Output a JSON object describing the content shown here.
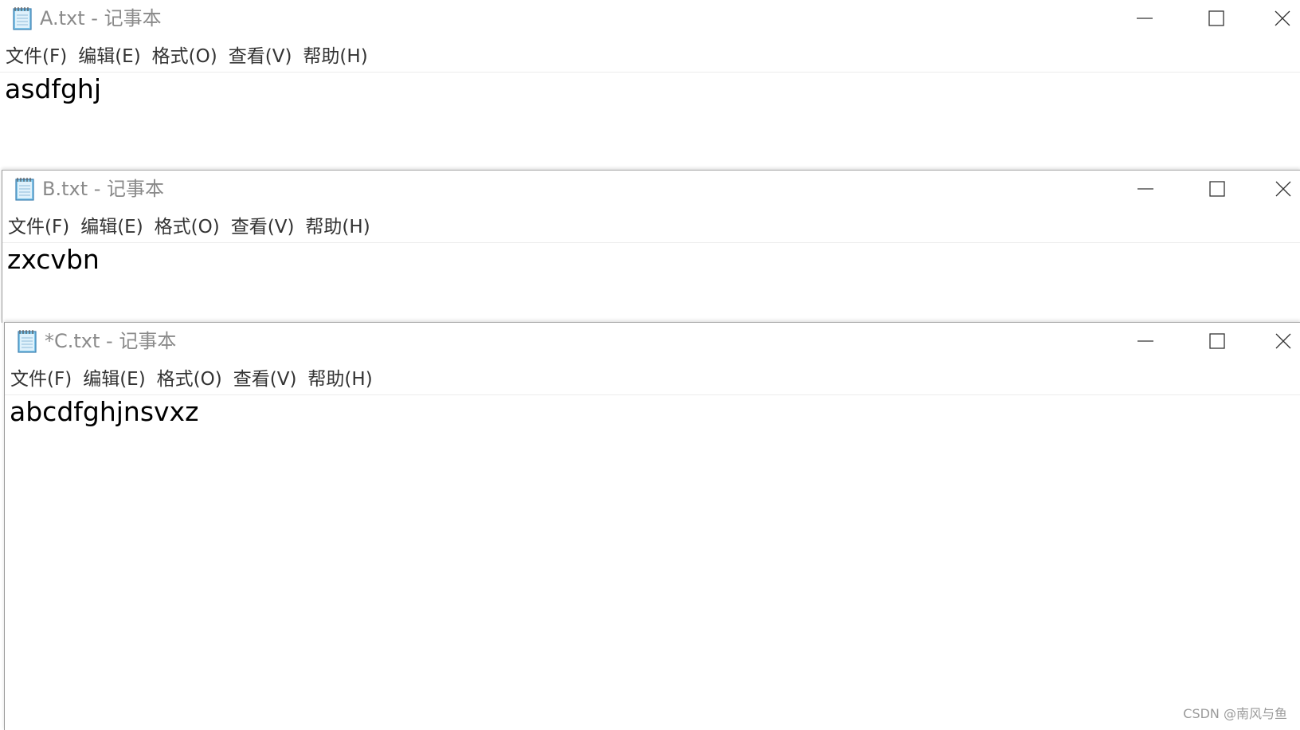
{
  "windows": [
    {
      "title": "A.txt - 记事本",
      "menu": [
        "文件(F)",
        "编辑(E)",
        "格式(O)",
        "查看(V)",
        "帮助(H)"
      ],
      "content": "asdfghj",
      "icon": "notepad-icon"
    },
    {
      "title": "B.txt - 记事本",
      "menu": [
        "文件(F)",
        "编辑(E)",
        "格式(O)",
        "查看(V)",
        "帮助(H)"
      ],
      "content": "zxcvbn",
      "icon": "notepad-icon"
    },
    {
      "title": "*C.txt - 记事本",
      "menu": [
        "文件(F)",
        "编辑(E)",
        "格式(O)",
        "查看(V)",
        "帮助(H)"
      ],
      "content": "abcdfghjnsvxz",
      "icon": "notepad-icon"
    }
  ],
  "watermark": "CSDN @南风与鱼",
  "colors": {
    "title_text": "#8a8a8a",
    "menu_text": "#333333",
    "border": "#a8a8a8",
    "background": "#ffffff"
  }
}
